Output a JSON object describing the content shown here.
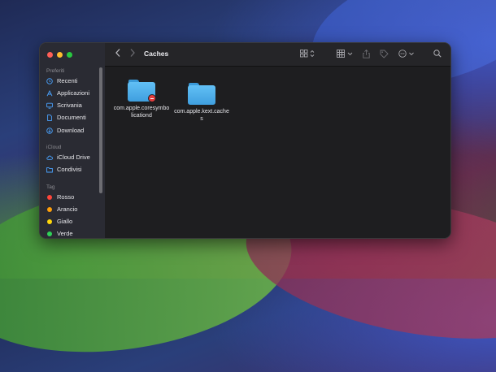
{
  "window": {
    "title": "Caches"
  },
  "sidebar": {
    "favorites_label": "Preferiti",
    "favorites": [
      {
        "label": "Recenti",
        "icon": "clock-icon"
      },
      {
        "label": "Applicazioni",
        "icon": "applications-icon"
      },
      {
        "label": "Scrivania",
        "icon": "desktop-icon"
      },
      {
        "label": "Documenti",
        "icon": "document-icon"
      },
      {
        "label": "Download",
        "icon": "download-icon"
      }
    ],
    "icloud_label": "iCloud",
    "icloud": [
      {
        "label": "iCloud Drive",
        "icon": "cloud-icon"
      },
      {
        "label": "Condivisi",
        "icon": "shared-folder-icon"
      }
    ],
    "tags_label": "Tag",
    "tags": [
      {
        "label": "Rosso",
        "color": "#ff453a"
      },
      {
        "label": "Arancio",
        "color": "#ff9f0a"
      },
      {
        "label": "Giallo",
        "color": "#ffd60a"
      },
      {
        "label": "Verde",
        "color": "#30d158"
      }
    ]
  },
  "toolbar": {
    "back_icon": "chevron-left-icon",
    "forward_icon": "chevron-right-icon",
    "view_icon": "grid-view-icon",
    "group_icon": "group-icon",
    "share_icon": "share-icon",
    "tag_icon": "tag-icon",
    "more_icon": "ellipsis-circle-icon",
    "search_icon": "search-icon"
  },
  "files": [
    {
      "name": "com.apple.coresymbolicationd",
      "badge": "no-access",
      "icon": "folder-icon"
    },
    {
      "name": "com.apple.kext.caches",
      "badge": null,
      "icon": "folder-icon"
    }
  ]
}
